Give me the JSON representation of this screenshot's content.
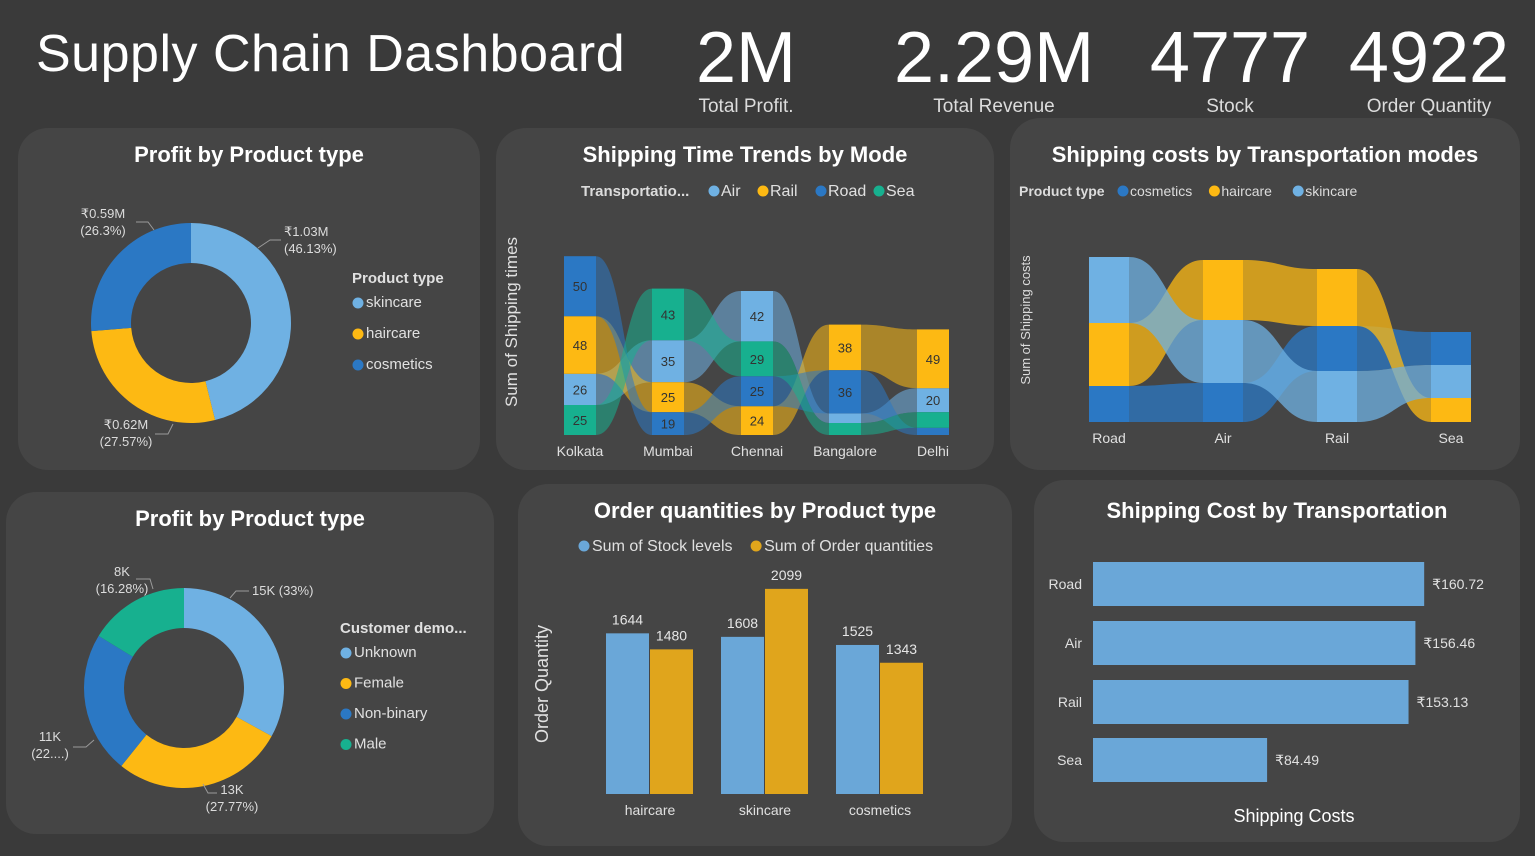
{
  "header": {
    "title": "Supply Chain Dashboard",
    "kpis": [
      {
        "value": "2M",
        "label": "Total Profit."
      },
      {
        "value": "2.29M",
        "label": "Total Revenue"
      },
      {
        "value": "4777",
        "label": "Stock"
      },
      {
        "value": "4922",
        "label": "Order Quantity"
      }
    ]
  },
  "colors": {
    "light_blue": "#6fb1e3",
    "yellow": "#fdb913",
    "dark_blue": "#2b78c4",
    "teal": "#17b08f",
    "bar_blue": "#6aa7d8",
    "bar_gold": "#e0a51c",
    "background": "#3a3a3a",
    "card": "#454545"
  },
  "card1": {
    "title": "Profit by Product type",
    "legend_title": "Product type",
    "chart_data": {
      "type": "pie",
      "variant": "donut",
      "slices": [
        {
          "name": "skincare",
          "label": "₹1.03M",
          "pct_label": "(46.13%)",
          "pct": 46.13,
          "color": "#6fb1e3"
        },
        {
          "name": "haircare",
          "label": "₹0.62M",
          "pct_label": "(27.57%)",
          "pct": 27.57,
          "color": "#fdb913"
        },
        {
          "name": "cosmetics",
          "label": "₹0.59M",
          "pct_label": "(26.3%)",
          "pct": 26.3,
          "color": "#2b78c4"
        }
      ]
    }
  },
  "card2": {
    "title": "Shipping Time Trends by Mode",
    "legend_title": "Transportatio...",
    "ylabel": "Sum of Shipping times",
    "chart_data": {
      "type": "area",
      "variant": "ribbon",
      "categories": [
        "Kolkata",
        "Mumbai",
        "Chennai",
        "Bangalore",
        "Delhi"
      ],
      "series": [
        {
          "name": "Air",
          "color": "#6fb1e3",
          "values": [
            26,
            35,
            42,
            8,
            20
          ]
        },
        {
          "name": "Rail",
          "color": "#fdb913",
          "values": [
            48,
            25,
            24,
            38,
            49
          ]
        },
        {
          "name": "Road",
          "color": "#2b78c4",
          "values": [
            50,
            19,
            25,
            36,
            6
          ]
        },
        {
          "name": "Sea",
          "color": "#17b08f",
          "values": [
            25,
            43,
            29,
            10,
            13
          ]
        }
      ],
      "labels": [
        [
          "50",
          "48",
          "26",
          "25"
        ],
        [
          "43",
          "35",
          "25",
          "19"
        ],
        [
          "42",
          "29",
          "25",
          "24"
        ],
        [
          "38",
          "36"
        ],
        [
          "49",
          "20"
        ]
      ]
    }
  },
  "card3": {
    "title": "Shipping costs by Transportation modes",
    "legend_title": "Product type",
    "ylabel": "Sum of Shipping costs",
    "chart_data": {
      "type": "area",
      "variant": "ribbon",
      "categories": [
        "Road",
        "Air",
        "Rail",
        "Sea"
      ],
      "series": [
        {
          "name": "cosmetics",
          "color": "#2b78c4",
          "values": [
            120,
            130,
            150,
            110
          ]
        },
        {
          "name": "haircare",
          "color": "#fdb913",
          "values": [
            210,
            200,
            190,
            80
          ]
        },
        {
          "name": "skincare",
          "color": "#6fb1e3",
          "values": [
            220,
            210,
            170,
            110
          ]
        }
      ]
    }
  },
  "card4": {
    "title": "Profit by Product type",
    "legend_title": "Customer demo...",
    "chart_data": {
      "type": "pie",
      "variant": "donut",
      "slices": [
        {
          "name": "Unknown",
          "label": "15K (33%)",
          "pct_label": "",
          "pct": 33,
          "color": "#6fb1e3"
        },
        {
          "name": "Female",
          "label": "13K",
          "pct_label": "(27.77%)",
          "pct": 27.77,
          "color": "#fdb913"
        },
        {
          "name": "Non-binary",
          "label": "11K",
          "pct_label": "(22....)",
          "pct": 22.95,
          "color": "#2b78c4"
        },
        {
          "name": "Male",
          "label": "8K",
          "pct_label": "(16.28%)",
          "pct": 16.28,
          "color": "#17b08f"
        }
      ]
    }
  },
  "card5": {
    "title": "Order quantities by Product type",
    "ylabel": "Order Quantity",
    "chart_data": {
      "type": "bar",
      "categories": [
        "haircare",
        "skincare",
        "cosmetics"
      ],
      "series": [
        {
          "name": "Sum of Stock levels",
          "color": "#6aa7d8",
          "values": [
            1644,
            1608,
            1525
          ]
        },
        {
          "name": "Sum of Order quantities",
          "color": "#e0a51c",
          "values": [
            1480,
            2099,
            1343
          ]
        }
      ],
      "ylim": [
        0,
        2200
      ]
    }
  },
  "card6": {
    "title": "Shipping Cost by Transportation",
    "xlabel": "Shipping Costs",
    "chart_data": {
      "type": "bar",
      "orientation": "horizontal",
      "categories": [
        "Road",
        "Air",
        "Rail",
        "Sea"
      ],
      "values": [
        160.72,
        156.46,
        153.13,
        84.49
      ],
      "value_labels": [
        "₹160.72",
        "₹156.46",
        "₹153.13",
        "₹84.49"
      ],
      "xlim": [
        0,
        165
      ]
    }
  }
}
